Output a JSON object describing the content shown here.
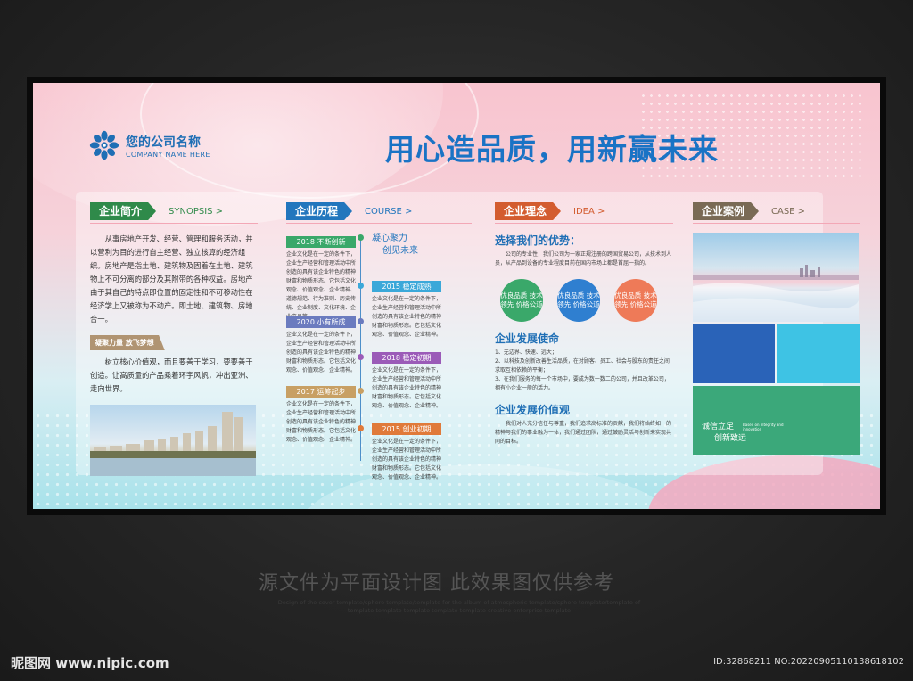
{
  "company": {
    "name_cn": "您的公司名称",
    "name_en": "COMPANY NAME HERE"
  },
  "slogan": "用心造品质，用新赢未来",
  "synopsis": {
    "tag": "企业简介",
    "tag_en": "SYNOPSIS >",
    "body": "从事房地产开发、经营、管理和服务活动，并以营利为目的进行自主经营、独立核算的经济组织。房地产是指土地、建筑物及固着在土地、建筑物上不可分离的部分及其附带的各种权益。房地产由于其自己的特点即位置的固定性和不可移动性在经济学上又被称为不动产。即土地、建筑物、房地合一。",
    "sub_tag": "凝聚力量 放飞梦想",
    "body2": "树立核心价值观，而且要善于学习，要要善于创造。让高质量的产品乘着环宇风帆，冲出亚洲、走向世界。"
  },
  "course": {
    "tag": "企业历程",
    "tag_en": "COURSE >",
    "motto": [
      "凝心聚力",
      "创见未来"
    ],
    "items": [
      {
        "year": "2018 不断创新",
        "color": "#3aa86a",
        "text": "企业文化是在一定的条件下，企业生产经营和管理活动中所创造的具有该企业特色的精神财富和物质形态。它包括文化观念、价值观念、企业精神、道德规范、行为准则、历史传统、企业制度、文化环境、企业产品等。"
      },
      {
        "year": "2015 稳定成熟",
        "color": "#3ba8d9",
        "text": "企业文化是在一定的条件下，企业生产经营和管理活动中所创造的具有该企业特色的精神财富和物质形态。它包括文化观念、价值观念、企业精神。"
      },
      {
        "year": "2020 小有所成",
        "color": "#6b7bbf",
        "text": "企业文化是在一定的条件下，企业生产经营和管理活动中所创造的具有该企业特色的精神财富和物质形态。它包括文化观念、价值观念、企业精神。"
      },
      {
        "year": "2018 稳定初期",
        "color": "#9b5bb8",
        "text": "企业文化是在一定的条件下，企业生产经营和管理活动中所创造的具有该企业特色的精神财富和物质形态。它包括文化观念、价值观念、企业精神。"
      },
      {
        "year": "2017 运筹起步",
        "color": "#c8a064",
        "text": "企业文化是在一定的条件下，企业生产经营和管理活动中所创造的具有该企业特色的精神财富和物质形态。它包括文化观念、价值观念、企业精神。"
      },
      {
        "year": "2015 创业初期",
        "color": "#e07a3a",
        "text": "企业文化是在一定的条件下，企业生产经营和管理活动中所创造的具有该企业特色的精神财富和物质形态。它包括文化观念、价值观念、企业精神。"
      }
    ]
  },
  "idea": {
    "tag": "企业理念",
    "tag_en": "IDEA >",
    "advantage_title": "选择我们的优势：",
    "advantage_text": "公司的专业性，我们公司为一家正规注册的跨国贸易公司，从技术到人员，从产品到设备的专业程度目前在国内市场上都是首屈一指的。",
    "circles": [
      {
        "text": "优良品质 技术领先 价格公道",
        "color": "#3aa86a"
      },
      {
        "text": "优良品质 技术领先 价格公道",
        "color": "#2f7fd0"
      },
      {
        "text": "优良品质 技术领先 价格公道",
        "color": "#ee7a58"
      }
    ],
    "mission_title": "企业发展使命",
    "mission_items": [
      "1、无边界、快速、远大；",
      "2、以科技及创新改善生活品质，在对顾客、员工、社会与股东的责任之间求取互相依赖的平衡；",
      "3、在我们服务的每一个市场中，要成为数一数二的公司，并且改革公司，拥有小企业一般的活力。"
    ],
    "values_title": "企业发展价值观",
    "values_text": "我们对人充分信任与尊重，我们追求高标准的贡献，我们将始终如一的精神与我们的事业融为一体，我们通过团队，通过鼓励灵活与创新来实现共同的目标。"
  },
  "case": {
    "tag": "企业案例",
    "tag_en": "CASE >",
    "motto": [
      "诚信立足",
      "创新致远"
    ],
    "motto_en": "Based on integrity and innovation"
  },
  "footer": {
    "cn": "源文件为平面设计图 此效果图仅供参考",
    "en": "Design of the cover template/sphere template/template for the album of atmospheric template/sphere template/template of template template template template template creative enterprise template"
  },
  "watermark": {
    "site": "昵图网 www.nipic.com",
    "id": "ID:32868211 NO:20220905110138618102"
  }
}
